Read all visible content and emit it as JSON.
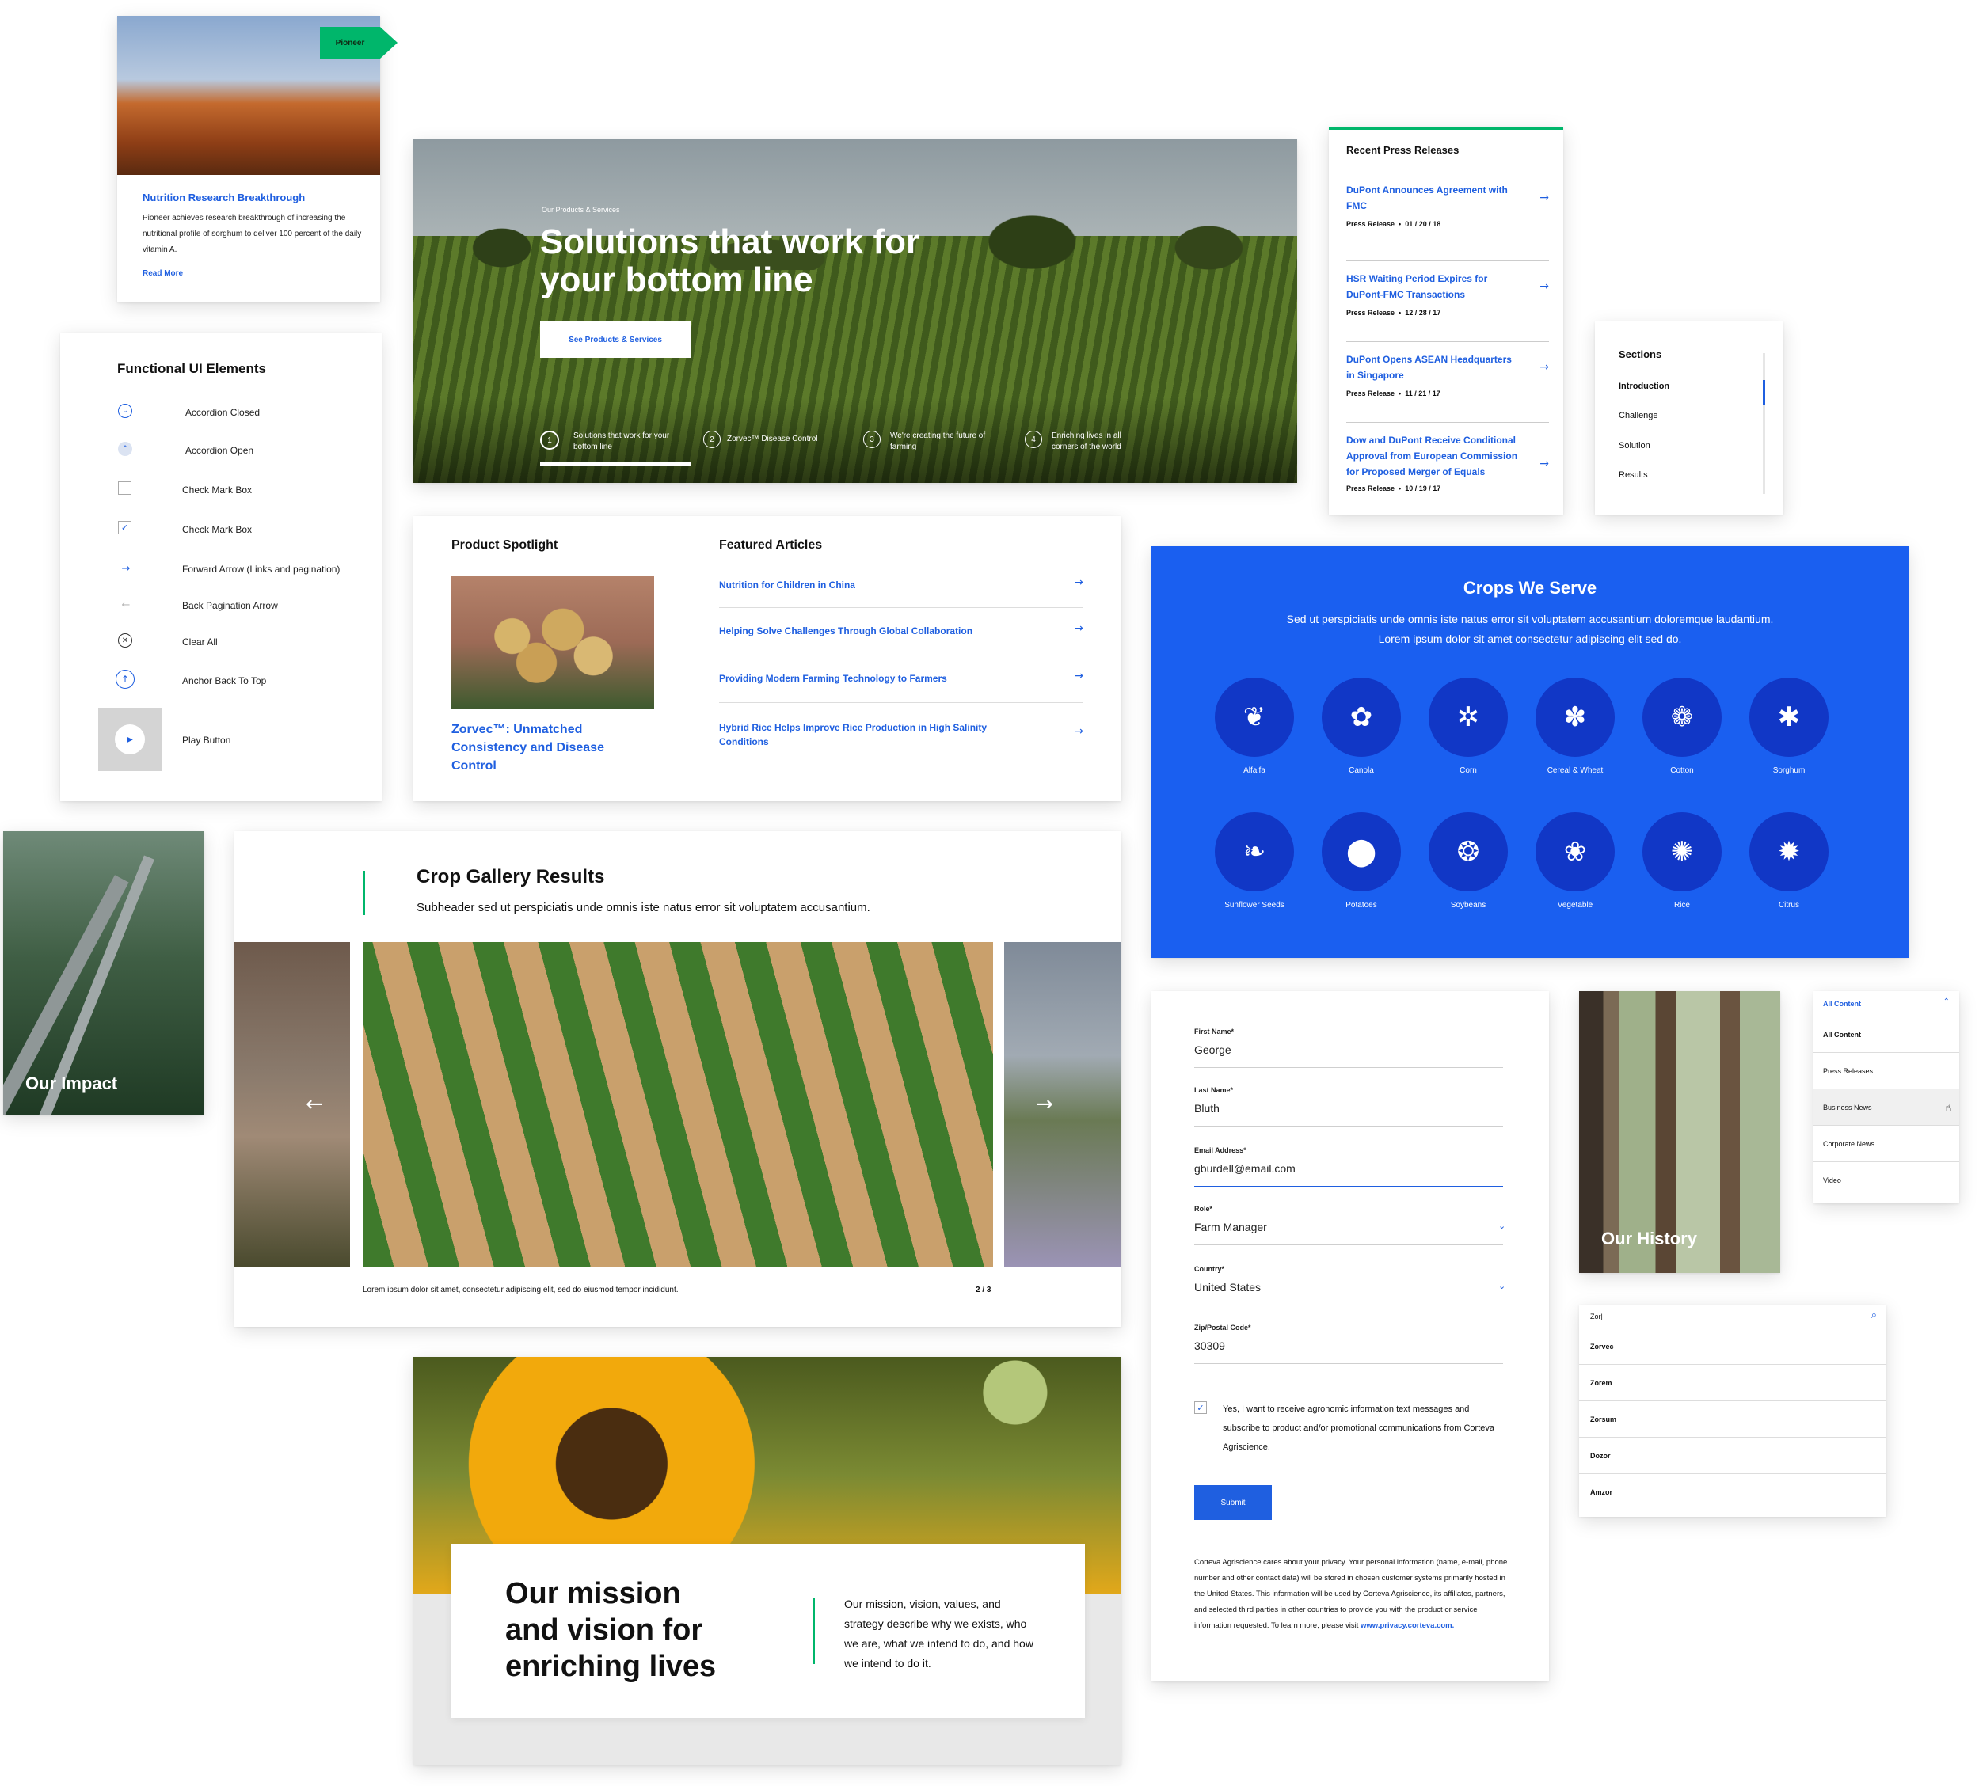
{
  "news_card": {
    "tag": "Pioneer",
    "title": "Nutrition Research Breakthrough",
    "body": "Pioneer achieves research breakthrough of increasing the nutritional profile of sorghum to deliver 100 percent of the daily vitamin A.",
    "link": "Read More"
  },
  "hero": {
    "eyebrow": "Our Products & Services",
    "headline_line1": "Solutions that work for",
    "headline_line2": "your bottom line",
    "cta": "See Products & Services",
    "slides": [
      {
        "num": "1",
        "label": "Solutions that work for your bottom line"
      },
      {
        "num": "2",
        "label": "Zorvec™ Disease Control"
      },
      {
        "num": "3",
        "label": "We're creating the future of farming"
      },
      {
        "num": "4",
        "label": "Enriching lives in all corners of the world"
      }
    ]
  },
  "press": {
    "title": "Recent Press Releases",
    "items": [
      {
        "title": "DuPont Announces Agreement with FMC",
        "meta": "Press Release  •  01 / 20 / 18"
      },
      {
        "title": "HSR Waiting Period Expires for DuPont-FMC Transactions",
        "meta": "Press Release  •  12 / 28 / 17"
      },
      {
        "title": "DuPont Opens ASEAN Headquarters in Singapore",
        "meta": "Press Release  •  11 / 21 / 17"
      },
      {
        "title": "Dow and DuPont Receive Conditional Approval from European Commission for Proposed Merger of Equals",
        "meta": "Press Release  •  10 / 19 / 17"
      }
    ]
  },
  "sections": {
    "title": "Sections",
    "items": [
      "Introduction",
      "Challenge",
      "Solution",
      "Results"
    ]
  },
  "functional": {
    "title": "Functional UI Elements",
    "items": [
      {
        "icon": "accordion-closed-icon",
        "label": "Accordion Closed"
      },
      {
        "icon": "accordion-open-icon",
        "label": "Accordion Open"
      },
      {
        "icon": "checkbox-empty-icon",
        "label": "Check Mark Box"
      },
      {
        "icon": "checkbox-checked-icon",
        "label": "Check Mark Box"
      },
      {
        "icon": "forward-arrow-icon",
        "label": "Forward Arrow (Links and pagination)"
      },
      {
        "icon": "back-arrow-icon",
        "label": "Back Pagination Arrow"
      },
      {
        "icon": "clear-all-icon",
        "label": "Clear All"
      },
      {
        "icon": "back-to-top-icon",
        "label": "Anchor Back To Top"
      },
      {
        "icon": "play-icon",
        "label": "Play Button"
      }
    ]
  },
  "spotlight": {
    "title": "Product Spotlight",
    "product": "Zorvec™: Unmatched Consistency and Disease Control"
  },
  "featured": {
    "title": "Featured Articles",
    "items": [
      "Nutrition for Children in China",
      "Helping Solve Challenges Through Global Collaboration",
      "Providing Modern Farming Technology to Farmers",
      "Hybrid Rice Helps Improve Rice Production in High Salinity Conditions"
    ]
  },
  "crops": {
    "title": "Crops We Serve",
    "description": "Sed ut perspiciatis unde omnis iste natus error sit voluptatem accusantium doloremque laudantium. Lorem ipsum dolor sit amet consectetur adipiscing elit sed do.",
    "items": [
      {
        "label": "Alfalfa",
        "icon": "alfalfa-icon"
      },
      {
        "label": "Canola",
        "icon": "canola-icon"
      },
      {
        "label": "Corn",
        "icon": "corn-icon"
      },
      {
        "label": "Cereal & Wheat",
        "icon": "wheat-icon"
      },
      {
        "label": "Cotton",
        "icon": "cotton-icon"
      },
      {
        "label": "Sorghum",
        "icon": "sorghum-icon"
      },
      {
        "label": "Sunflower Seeds",
        "icon": "sunflower-seeds-icon"
      },
      {
        "label": "Potatoes",
        "icon": "potatoes-icon"
      },
      {
        "label": "Soybeans",
        "icon": "soybeans-icon"
      },
      {
        "label": "Vegetable",
        "icon": "vegetable-icon"
      },
      {
        "label": "Rice",
        "icon": "rice-icon"
      },
      {
        "label": "Citrus",
        "icon": "citrus-icon"
      }
    ],
    "accent": "#1a5ff0"
  },
  "impact": {
    "label": "Our Impact"
  },
  "gallery": {
    "title": "Crop Gallery Results",
    "subheader": "Subheader sed ut perspiciatis unde omnis iste natus error sit voluptatem accusantium.",
    "caption": "Lorem ipsum dolor sit amet, consectetur adipiscing elit, sed do eiusmod tempor incididunt.",
    "counter": "2 / 3"
  },
  "form": {
    "fields": [
      {
        "label": "First Name*",
        "value": "George"
      },
      {
        "label": "Last Name*",
        "value": "Bluth"
      },
      {
        "label": "Email Address*",
        "value": "gburdell@email.com"
      },
      {
        "label": "Role*",
        "value": "Farm Manager"
      },
      {
        "label": "Country*",
        "value": "United States"
      },
      {
        "label": "Zip/Postal Code*",
        "value": "30309"
      }
    ],
    "consent": "Yes, I want to receive agronomic information text messages and subscribe to product and/or promotional communications from Corteva Agriscience.",
    "submit": "Submit",
    "privacy": "Corteva Agriscience cares about your privacy. Your personal information (name, e-mail, phone number and other contact data) will be stored in chosen customer systems primarily hosted in the United States. This information will be used by Corteva Agriscience, its affiliates, partners, and selected third parties in other countries to provide you with the product or service information requested. To learn more, please visit",
    "privacy_link": "www.privacy.corteva.com."
  },
  "history": {
    "label": "Our History"
  },
  "filter": {
    "selected": "All Content",
    "options": [
      "All Content",
      "Press Releases",
      "Business News",
      "Corporate News",
      "Video"
    ]
  },
  "search": {
    "query": "Zor|",
    "results": [
      "Zorvec",
      "Zorem",
      "Zorsum",
      "Dozor",
      "Amzor"
    ]
  },
  "mission": {
    "headline_line1": "Our mission",
    "headline_line2": "and vision for",
    "headline_line3": "enriching lives",
    "body": "Our mission, vision, values, and strategy describe why we exists, who we are, what we intend to do, and how we intend to do it."
  },
  "colors": {
    "brand_blue": "#1f5fe0",
    "brand_green": "#00b66b"
  }
}
